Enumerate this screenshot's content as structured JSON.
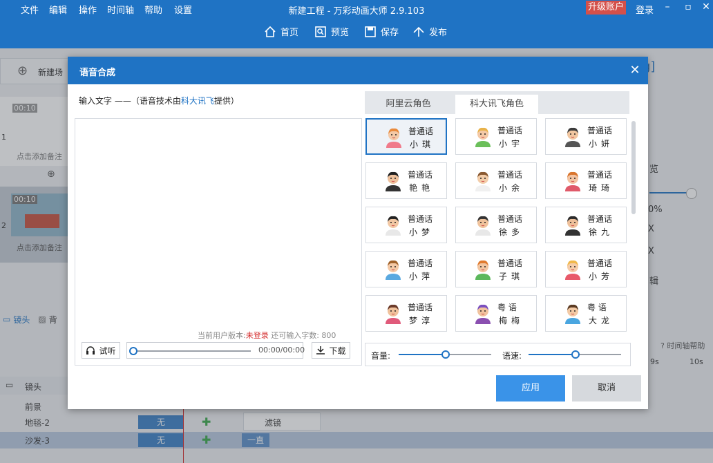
{
  "menu": {
    "items": [
      "文件",
      "编辑",
      "操作",
      "时间轴",
      "帮助",
      "设置"
    ],
    "title": "新建工程 - 万彩动画大师 2.9.103",
    "upgrade": "升级账户",
    "login": "登录"
  },
  "toolbar": {
    "home": "首页",
    "preview": "预览",
    "save": "保存",
    "publish": "发布"
  },
  "background": {
    "new_scene": "新建场",
    "scene_time_1": "00:10",
    "scene_time_2": "00:10",
    "scene_num_1": "1",
    "scene_num_2": "2",
    "add_note": "点击添加备注",
    "add_note2": "点击添加备注",
    "lens_tab": "镜头",
    "bg_tab": "背",
    "lens_row": "镜头",
    "track_1": "前景",
    "track_2": "地毯-2",
    "track_3": "沙发-3",
    "none_1": "无",
    "none_2": "无",
    "always": "一直",
    "filter": "滤镜",
    "timeline_help": "时间轴帮助",
    "tick_9s": "9s",
    "tick_10s": "10s",
    "right_preview": "览",
    "right_percent": "0%",
    "right_x1": "X",
    "right_x2": "X",
    "right_edit": "辑",
    "right_bracket": "g]"
  },
  "dialog": {
    "title": "语音合成",
    "input_label_pre": "输入文字 ——（语音技术由",
    "input_label_link": "科大讯飞",
    "input_label_post": "提供）",
    "status_pre": "当前用户版本:",
    "status_login": "未登录",
    "status_post": " 还可输入字数: 800",
    "listen": "试听",
    "time": "00:00/00:00",
    "download": "下载",
    "tabs": [
      "阿里云角色",
      "科大讯飞角色"
    ],
    "active_tab": 1,
    "voices": [
      {
        "lang": "普通话",
        "name": "小琪",
        "selected": true
      },
      {
        "lang": "普通话",
        "name": "小宇"
      },
      {
        "lang": "普通话",
        "name": "小妍"
      },
      {
        "lang": "普通话",
        "name": "艳艳"
      },
      {
        "lang": "普通话",
        "name": "小余"
      },
      {
        "lang": "普通话",
        "name": "琦琦"
      },
      {
        "lang": "普通话",
        "name": "小梦"
      },
      {
        "lang": "普通话",
        "name": "徐多"
      },
      {
        "lang": "普通话",
        "name": "徐九"
      },
      {
        "lang": "普通话",
        "name": "小萍"
      },
      {
        "lang": "普通话",
        "name": "子琪"
      },
      {
        "lang": "普通话",
        "name": "小芳"
      },
      {
        "lang": "普通话",
        "name": "梦淳"
      },
      {
        "lang": "粤 语",
        "name": "梅梅"
      },
      {
        "lang": "粤 语",
        "name": "大龙"
      }
    ],
    "volume_label": "音量:",
    "speed_label": "语速:",
    "volume_value": 0.5,
    "speed_value": 0.5,
    "apply": "应用",
    "cancel": "取消"
  }
}
